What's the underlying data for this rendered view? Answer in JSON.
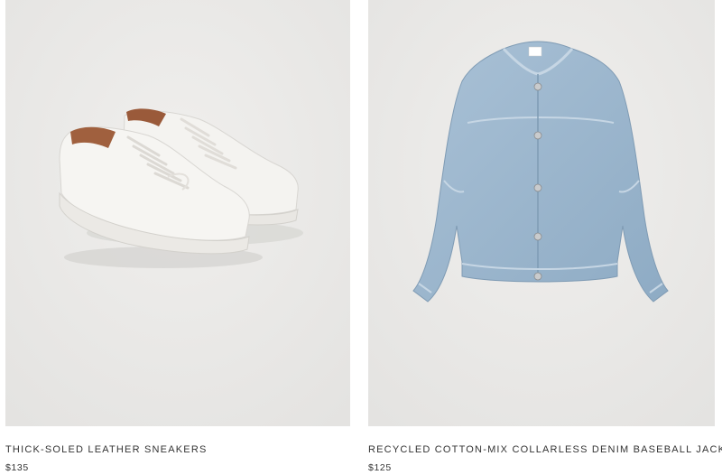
{
  "products": [
    {
      "name": "THICK-SOLED LEATHER SNEAKERS",
      "price": "$135",
      "image_subject": "white-leather-sneakers",
      "image_bg": "#ebeae8"
    },
    {
      "name": "RECYCLED COTTON-MIX COLLARLESS DENIM BASEBALL JACKET",
      "price": "$125",
      "image_subject": "light-blue-denim-jacket",
      "image_bg": "#ebeae8"
    }
  ]
}
